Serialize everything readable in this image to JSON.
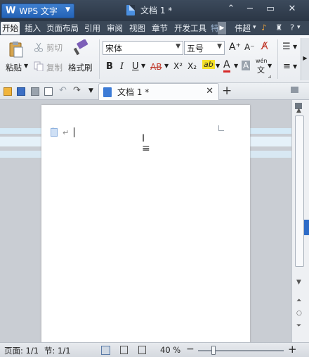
{
  "app": {
    "logo_label": "WPS 文字"
  },
  "window": {
    "title": "文档 1 *",
    "controls": [
      "⌃",
      "−",
      "▭",
      "✕"
    ]
  },
  "menu": {
    "items": [
      "开始",
      "插入",
      "页面布局",
      "引用",
      "审阅",
      "视图",
      "章节",
      "开发工具",
      "特"
    ],
    "right_items": [
      "伟超",
      "?"
    ]
  },
  "ribbon": {
    "paste_label": "粘贴",
    "cut_label": "剪切",
    "copy_label": "复制",
    "format_painter_label": "格式刷",
    "font_name": "宋体",
    "font_size": "五号",
    "bold": "B",
    "italic": "I",
    "underline": "U",
    "strike": "AB",
    "superscript": "X²",
    "subscript": "X₂",
    "highlight": "ab",
    "font_color": "A",
    "char_shading": "A",
    "phonetic": "wén",
    "grow_font": "A⁺",
    "shrink_font": "A⁻",
    "phonetic_char": "文"
  },
  "tabs": [
    {
      "label": "文档 1 *",
      "close": "✕"
    }
  ],
  "new_tab": "+",
  "status": {
    "page": "页面: 1/1",
    "section": "节: 1/1",
    "zoom": "40 %",
    "zoom_minus": "−",
    "zoom_plus": "+",
    "zoom_level": 0.18
  },
  "colors": {
    "title_bar": "#2b3645",
    "app_button": "#2463b6",
    "accent_blue": "#2d6bc7"
  }
}
